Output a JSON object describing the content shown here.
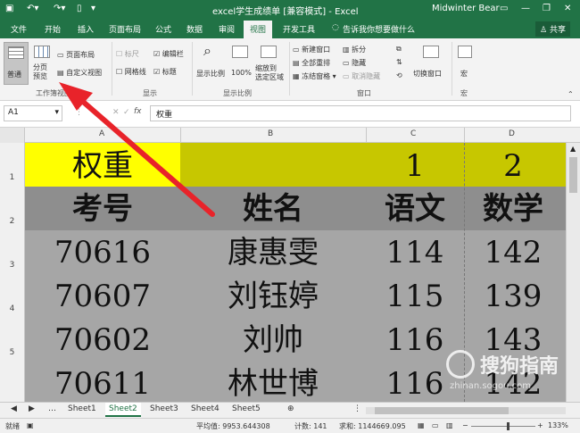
{
  "titlebar": {
    "title": "excel学生成绩单 [兼容模式] - Excel",
    "user": "Midwinter Bear"
  },
  "tabs": [
    "文件",
    "开始",
    "插入",
    "页面布局",
    "公式",
    "数据",
    "审阅",
    "视图",
    "开发工具"
  ],
  "tell_me": "告诉我你想要做什么",
  "share": "共享",
  "ribbon": {
    "normal": "普通",
    "page_break": "分页\n预览",
    "page_layout": "页面布局",
    "custom_views": "自定义视图",
    "ruler": "标尺",
    "formula_bar": "编辑栏",
    "gridlines": "网格线",
    "headings": "标题",
    "zoom": "显示比例",
    "zoom100": "100%",
    "zoom_selection": "缩放到\n选定区域",
    "new_window": "新建窗口",
    "arrange_all": "全部重排",
    "freeze": "冻结窗格",
    "split": "拆分",
    "hide": "隐藏",
    "unhide": "取消隐藏",
    "switch_window": "切换窗口",
    "macros": "宏",
    "groups": [
      "工作簿视图",
      "显示",
      "显示比例",
      "窗口",
      "宏"
    ]
  },
  "namebox": "A1",
  "formula": "权重",
  "columns": [
    "A",
    "B",
    "C",
    "D"
  ],
  "rows": [
    "1",
    "2",
    "3",
    "4",
    "5"
  ],
  "cells": [
    [
      "权重",
      "",
      "1",
      "2"
    ],
    [
      "考号",
      "姓名",
      "语文",
      "数学"
    ],
    [
      "70616",
      "康惠雯",
      "114",
      "142"
    ],
    [
      "70607",
      "刘钰婷",
      "115",
      "139"
    ],
    [
      "70602",
      "刘帅",
      "116",
      "143"
    ],
    [
      "70611",
      "林世博",
      "116",
      "142"
    ]
  ],
  "sheets": [
    "Sheet1",
    "Sheet2",
    "Sheet3",
    "Sheet4",
    "Sheet5"
  ],
  "status": {
    "ready": "就绪",
    "average": "平均值: 9953.644308",
    "count": "计数: 141",
    "sum": "求和: 1144669.095",
    "zoom": "133%"
  },
  "watermark": "搜狗指南",
  "watermark_url": "zhinan.sogou.com"
}
